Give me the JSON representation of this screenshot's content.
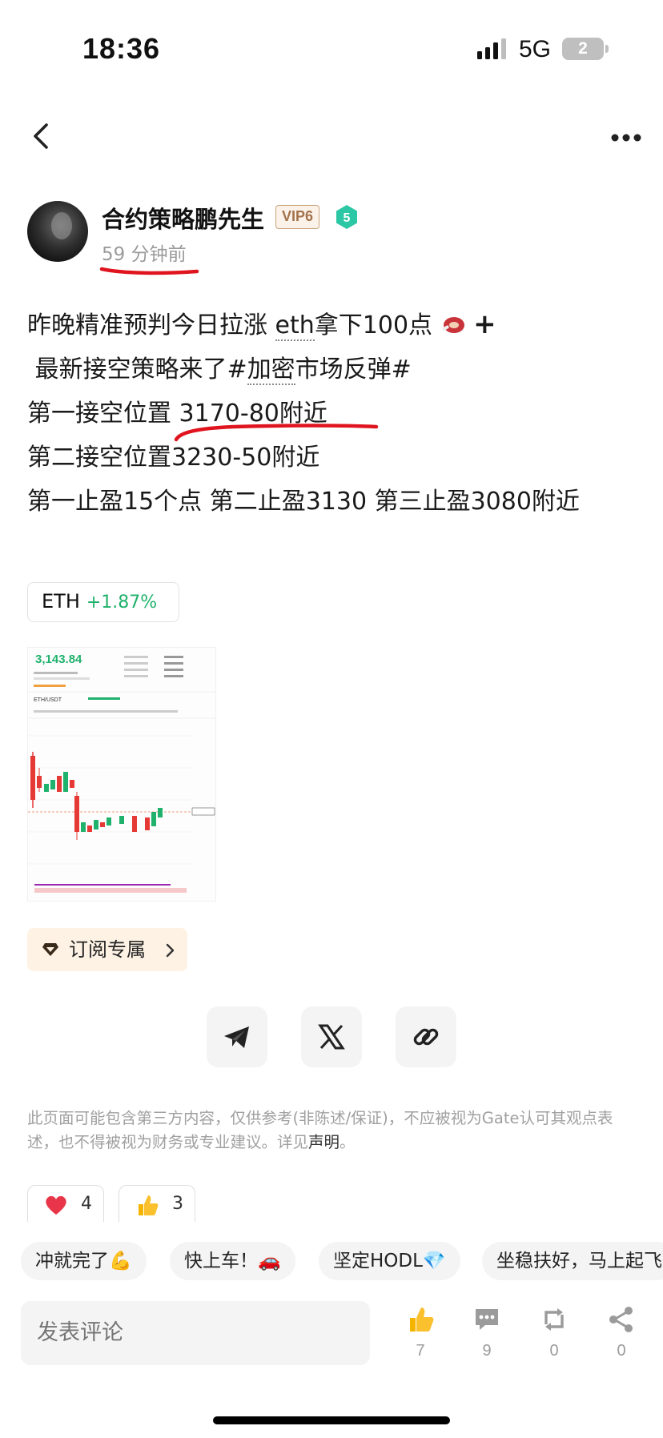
{
  "status_bar": {
    "time": "18:36",
    "network": "5G",
    "battery": "2"
  },
  "post": {
    "author": "合约策略鹏先生",
    "vip_badge": "VIP6",
    "level_badge": "5",
    "time_ago": "59 分钟前",
    "lines": [
      "昨晚精准预判今日拉涨",
      "eth",
      "拿下100点",
      "+",
      "最新接空策略来了#",
      "加密",
      "市场反弹#",
      "第一接空位置 3170-80附近",
      "第二接空位置3230-50附近",
      "第一止盈15个点 第二止盈3130 第三止盈3080附近"
    ]
  },
  "ticker": {
    "symbol": "ETH",
    "change": "+1.87%"
  },
  "chart_thumb": {
    "price": "3,143.84",
    "pair": "ETH/USDT"
  },
  "chart_data": {
    "type": "candlestick",
    "title": "",
    "last_price": 3143.84,
    "pair": "ETH/USDT"
  },
  "subscribe": {
    "label": "订阅专属"
  },
  "share": {
    "items": [
      "telegram-icon",
      "x-icon",
      "link-icon"
    ]
  },
  "disclaimer": {
    "text": "此页面可能包含第三方内容，仅供参考(非陈述/保证)，不应被视为Gate认可其观点表述，也不得被视为财务或专业建议。详见",
    "link": "声明",
    "end": "。"
  },
  "reactions": [
    {
      "icon": "heart-icon",
      "count": "4"
    },
    {
      "icon": "thumbs-up-icon",
      "count": "3"
    }
  ],
  "quick_replies": [
    "冲就完了💪",
    "快上车！🚗",
    "坚定HODL💎",
    "坐稳扶好，马上起飞"
  ],
  "comment": {
    "placeholder": "发表评论"
  },
  "actions": [
    {
      "icon": "thumbs-up-icon",
      "count": "7"
    },
    {
      "icon": "comment-icon",
      "count": "9"
    },
    {
      "icon": "repost-icon",
      "count": "0"
    },
    {
      "icon": "share-icon",
      "count": "0"
    }
  ],
  "colors": {
    "accent_green": "#20b26c",
    "vip_gold": "#a4724a",
    "level_green": "#2cc7a4",
    "annotation_red": "#e0141e"
  }
}
